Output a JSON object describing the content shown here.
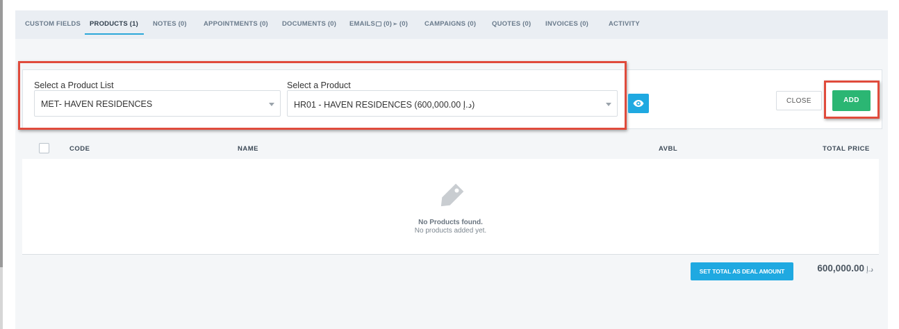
{
  "tabs": [
    {
      "label": "CUSTOM FIELDS",
      "active": false
    },
    {
      "label": "PRODUCTS (1)",
      "active": true
    },
    {
      "label": "NOTES (0)",
      "active": false
    },
    {
      "label": "APPOINTMENTS (0)",
      "active": false
    },
    {
      "label": "DOCUMENTS (0)",
      "active": false
    },
    {
      "label_prefix": "EMAILS",
      "label_mid": "(0)",
      "label_suffix": "(0)",
      "active": false
    },
    {
      "label": "CAMPAIGNS (0)",
      "active": false
    },
    {
      "label": "QUOTES (0)",
      "active": false
    },
    {
      "label": "INVOICES (0)",
      "active": false
    },
    {
      "label": "ACTIVITY",
      "active": false
    }
  ],
  "product_form": {
    "list_label": "Select a Product List",
    "list_value": "MET- HAVEN RESIDENCES",
    "product_label": "Select a Product",
    "product_value": "HR01 - HAVEN RESIDENCES (600,000.00 د.إ)",
    "close_label": "CLOSE",
    "add_label": "ADD"
  },
  "table": {
    "columns": {
      "code": "CODE",
      "name": "NAME",
      "avbl": "AVBL",
      "total_price": "TOTAL PRICE"
    },
    "empty_title": "No Products found.",
    "empty_subtitle": "No products added yet."
  },
  "footer": {
    "set_total_label": "SET TOTAL AS DEAL AMOUNT",
    "total_value": "600,000.00",
    "currency": "د.إ"
  },
  "colors": {
    "accent_blue": "#1fa9e1",
    "add_green": "#2bb673",
    "highlight_red": "#e04b3c"
  },
  "icons": {
    "eye": "eye-icon",
    "tag": "price-tag-icon",
    "email": "envelope-icon",
    "sent": "send-icon"
  }
}
